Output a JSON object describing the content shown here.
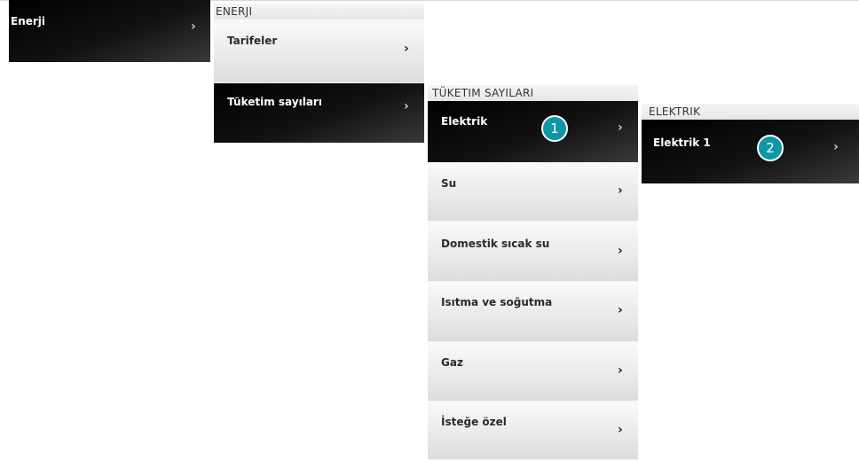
{
  "level1": {
    "item": {
      "label": "Enerji",
      "chevron": "›"
    }
  },
  "level2": {
    "header": "ENERJI",
    "items": [
      {
        "label": "Tarifeler",
        "chevron": "›"
      },
      {
        "label": "Tüketim sayıları",
        "chevron": "›"
      }
    ]
  },
  "level3": {
    "header": "TÜKETIM SAYILARI",
    "items": [
      {
        "label": "Elektrik",
        "chevron": "›"
      },
      {
        "label": "Su",
        "chevron": "›"
      },
      {
        "label": "Domestik sıcak su",
        "chevron": "›"
      },
      {
        "label": "Isıtma ve soğutma",
        "chevron": "›"
      },
      {
        "label": "Gaz",
        "chevron": "›"
      },
      {
        "label": "İsteğe özel",
        "chevron": "›"
      }
    ]
  },
  "level4": {
    "header": "ELEKTRIK",
    "items": [
      {
        "label": "Elektrik 1",
        "chevron": "›"
      }
    ]
  },
  "badges": {
    "first": "1",
    "second": "2"
  },
  "colors": {
    "badge": "#0d97a6",
    "selected_bg": "#000000",
    "item_bg": "#f0f0f0"
  }
}
